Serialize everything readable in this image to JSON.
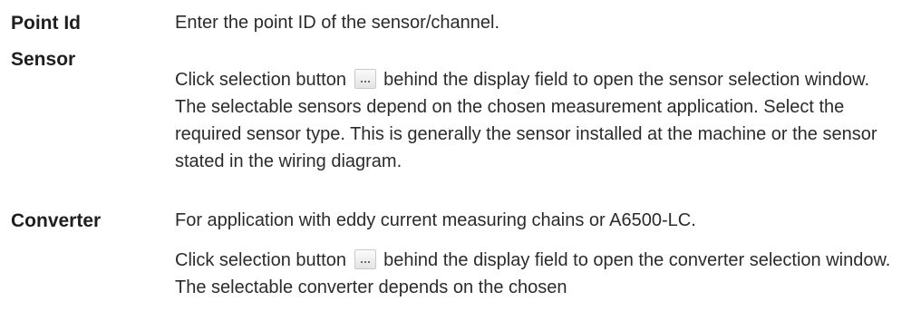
{
  "definitions": [
    {
      "term": "Point Id",
      "desc_1": "Enter the point ID of the sensor/channel."
    },
    {
      "term": "Sensor",
      "desc_1_before": "Click selection button",
      "desc_1_after": "behind the display field to open the sensor selection window. The selectable sensors depend on the chosen measurement application. Select the required sensor type. This is generally the sensor installed at the machine or the sensor stated in the wiring diagram."
    },
    {
      "term": "Converter",
      "desc_1": "For application with eddy current measuring chains or A6500-LC.",
      "desc_2_before": "Click selection button",
      "desc_2_after": "behind the display field to open the converter selection window. The selectable converter depends on the chosen"
    }
  ],
  "icons": {
    "selection_button": "ellipsis-button-icon"
  }
}
